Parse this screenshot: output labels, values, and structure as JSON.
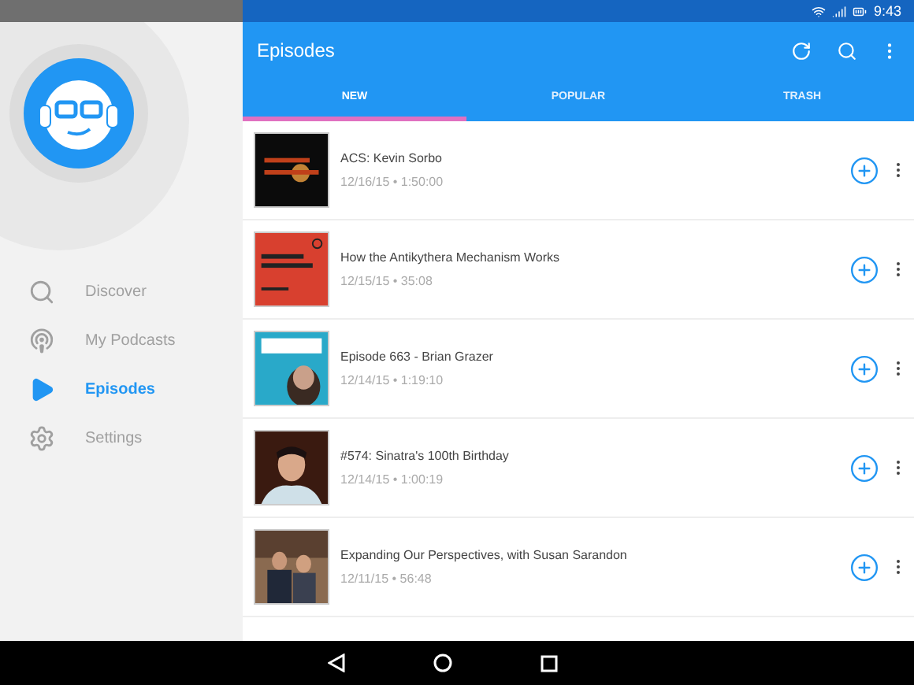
{
  "status_bar": {
    "time": "9:43"
  },
  "sidebar": {
    "items": [
      {
        "label": "Discover",
        "kind": "search",
        "selected": false
      },
      {
        "label": "My Podcasts",
        "kind": "podcast",
        "selected": false
      },
      {
        "label": "Episodes",
        "kind": "play",
        "selected": true
      },
      {
        "label": "Settings",
        "kind": "settings",
        "selected": false
      }
    ]
  },
  "app_bar": {
    "title": "Episodes"
  },
  "tabs": [
    {
      "label": "NEW",
      "selected": true
    },
    {
      "label": "POPULAR",
      "selected": false
    },
    {
      "label": "TRASH",
      "selected": false
    }
  ],
  "episodes": [
    {
      "title": "ACS: Kevin Sorbo",
      "meta": "12/16/15 • 1:50:00"
    },
    {
      "title": "How the Antikythera Mechanism Works",
      "meta": "12/15/15 • 35:08"
    },
    {
      "title": "Episode 663 - Brian Grazer",
      "meta": "12/14/15 • 1:19:10"
    },
    {
      "title": "#574: Sinatra's 100th Birthday",
      "meta": "12/14/15 • 1:00:19"
    },
    {
      "title": "Expanding Our Perspectives, with Susan Sarandon",
      "meta": "12/11/15 • 56:48"
    }
  ]
}
